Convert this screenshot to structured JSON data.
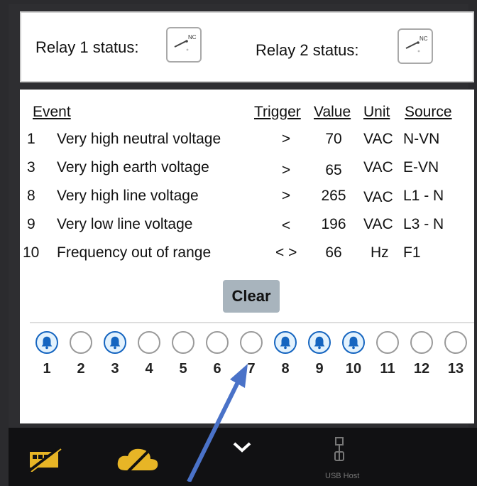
{
  "relays": {
    "relay1_label": "Relay 1 status:",
    "relay2_label": "Relay 2 status:",
    "relay_icon_text": "NC"
  },
  "table": {
    "headers": {
      "event": "Event",
      "trigger": "Trigger",
      "value": "Value",
      "unit": "Unit",
      "source": "Source"
    },
    "rows": [
      {
        "num": "1",
        "name": "Very high neutral voltage",
        "trigger": ">",
        "value": "70",
        "unit": "VAC",
        "source": "N-VN"
      },
      {
        "num": "3",
        "name": "Very high earth voltage",
        "trigger": ">",
        "value": "65",
        "unit": "VAC",
        "source": "E-VN"
      },
      {
        "num": "8",
        "name": "Very high line voltage",
        "trigger": ">",
        "value": "265",
        "unit": "VAC",
        "source": "L1 - N"
      },
      {
        "num": "9",
        "name": "Very low line voltage",
        "trigger": "<",
        "value": "196",
        "unit": "VAC",
        "source": "L3 - N"
      },
      {
        "num": "10",
        "name": "Frequency out of range",
        "trigger": "< >",
        "value": "66",
        "unit": "Hz",
        "source": "F1"
      }
    ]
  },
  "clear_label": "Clear",
  "indicators": [
    {
      "label": "1",
      "active": true
    },
    {
      "label": "2",
      "active": false
    },
    {
      "label": "3",
      "active": true
    },
    {
      "label": "4",
      "active": false
    },
    {
      "label": "5",
      "active": false
    },
    {
      "label": "6",
      "active": false
    },
    {
      "label": "7",
      "active": false
    },
    {
      "label": "8",
      "active": true
    },
    {
      "label": "9",
      "active": true
    },
    {
      "label": "10",
      "active": true
    },
    {
      "label": "11",
      "active": false
    },
    {
      "label": "12",
      "active": false
    },
    {
      "label": "13",
      "active": false
    }
  ],
  "nav": {
    "usb_label": "USB Host",
    "icon_names": [
      "network-disconnected-icon",
      "cloud-disconnected-icon",
      "chevron-down-icon",
      "usb-icon"
    ]
  },
  "colors": {
    "accent_blue": "#1565c0",
    "nav_yellow": "#e7b526",
    "arrow_blue": "#4a72c8"
  }
}
